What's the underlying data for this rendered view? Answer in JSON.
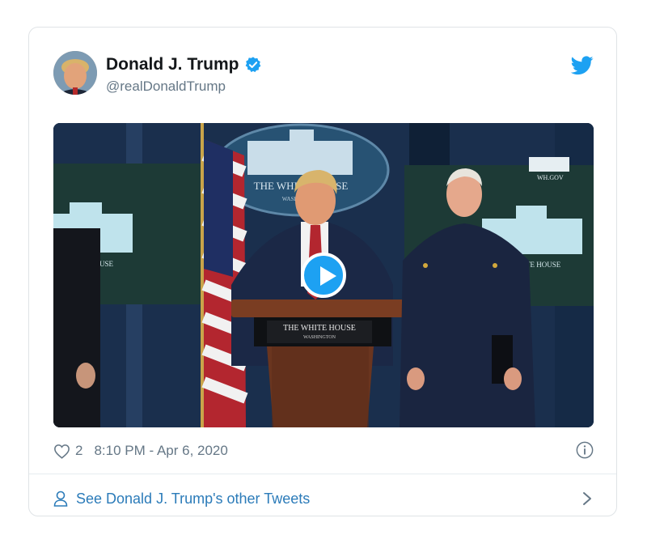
{
  "tweet": {
    "author_name": "Donald J. Trump",
    "handle": "@realDonaldTrump",
    "like_count": "2",
    "timestamp": "8:10 PM - Apr 6, 2020",
    "media": {
      "podium_text_line1": "THE WHITE HOUSE",
      "podium_text_line2": "WASHINGTON",
      "seal_text": "THE WHITE HOUSE",
      "seal_subtext": "WASHINGTON",
      "left_panel_text": "HOUSE",
      "right_panel_text": "TE HOUSE",
      "right_top_text": "WH.GOV"
    }
  },
  "footer": {
    "link_text": "See Donald J. Trump's other Tweets"
  },
  "icons": {
    "verified": "verified-badge-icon",
    "brand": "twitter-bird-icon",
    "like": "heart-icon",
    "info": "info-icon",
    "profile": "person-icon",
    "chevron": "chevron-right-icon",
    "play": "play-icon"
  },
  "colors": {
    "brand_blue": "#1da1f2",
    "link_blue": "#2b7bb9",
    "text_primary": "#14171a",
    "text_secondary": "#657786"
  }
}
